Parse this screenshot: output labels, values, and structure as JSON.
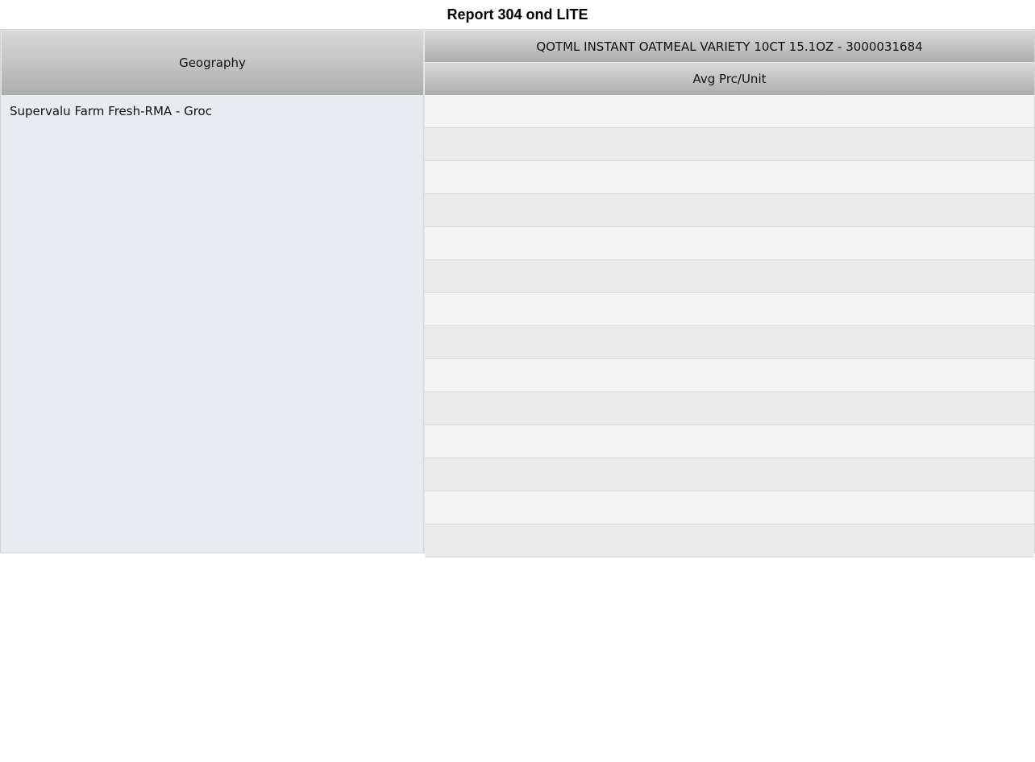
{
  "report": {
    "title": "Report 304 ond LITE"
  },
  "table": {
    "row_header_label": "Geography",
    "column_group_label": "QOTML INSTANT OATMEAL VARIETY 10CT 15.1OZ - 3000031684",
    "measure_label": "Avg Prc/Unit",
    "geography": "Supervalu Farm Fresh-RMA - Groc",
    "value_rows": [
      "",
      "",
      "",
      "",
      "",
      "",
      "",
      "",
      "",
      "",
      "",
      "",
      "",
      ""
    ]
  },
  "colors": {
    "header_gradient_top": "#d8d8d8",
    "header_gradient_bottom": "#acacac",
    "row_light": "#f5f5f5",
    "row_dark": "#ebebec",
    "geo_cell_bg": "#e8ebf0"
  }
}
